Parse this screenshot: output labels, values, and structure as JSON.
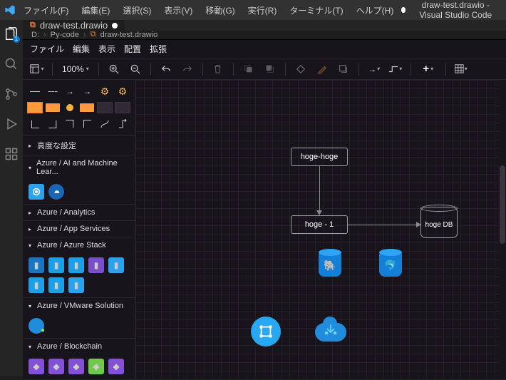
{
  "titlebar": {
    "menus": [
      "ファイル(F)",
      "編集(E)",
      "選択(S)",
      "表示(V)",
      "移動(G)",
      "実行(R)",
      "ターミナル(T)",
      "ヘルプ(H)"
    ],
    "title_file": "draw-test.drawio",
    "title_app": "Visual Studio Code"
  },
  "activity": {
    "explorer_badge": "1"
  },
  "tab": {
    "label": "draw-test.drawio"
  },
  "breadcrumb": {
    "parts": [
      "D:",
      "Py-code",
      "draw-test.drawio"
    ]
  },
  "drawio_menu": [
    "ファイル",
    "編集",
    "表示",
    "配置",
    "拡張"
  ],
  "toolbar": {
    "zoom": "100%"
  },
  "sidebar": {
    "advanced": "高度な設定",
    "sections": {
      "ai": "Azure / AI and Machine Lear...",
      "analytics": "Azure / Analytics",
      "appsvc": "Azure / App Services",
      "stack": "Azure / Azure Stack",
      "vmware": "Azure / VMware Solution",
      "blockchain": "Azure / Blockchain"
    }
  },
  "nodes": {
    "hoge_hoge": "hoge-hoge",
    "hoge1": "hoge - 1",
    "hoge_db": "hoge DB"
  }
}
